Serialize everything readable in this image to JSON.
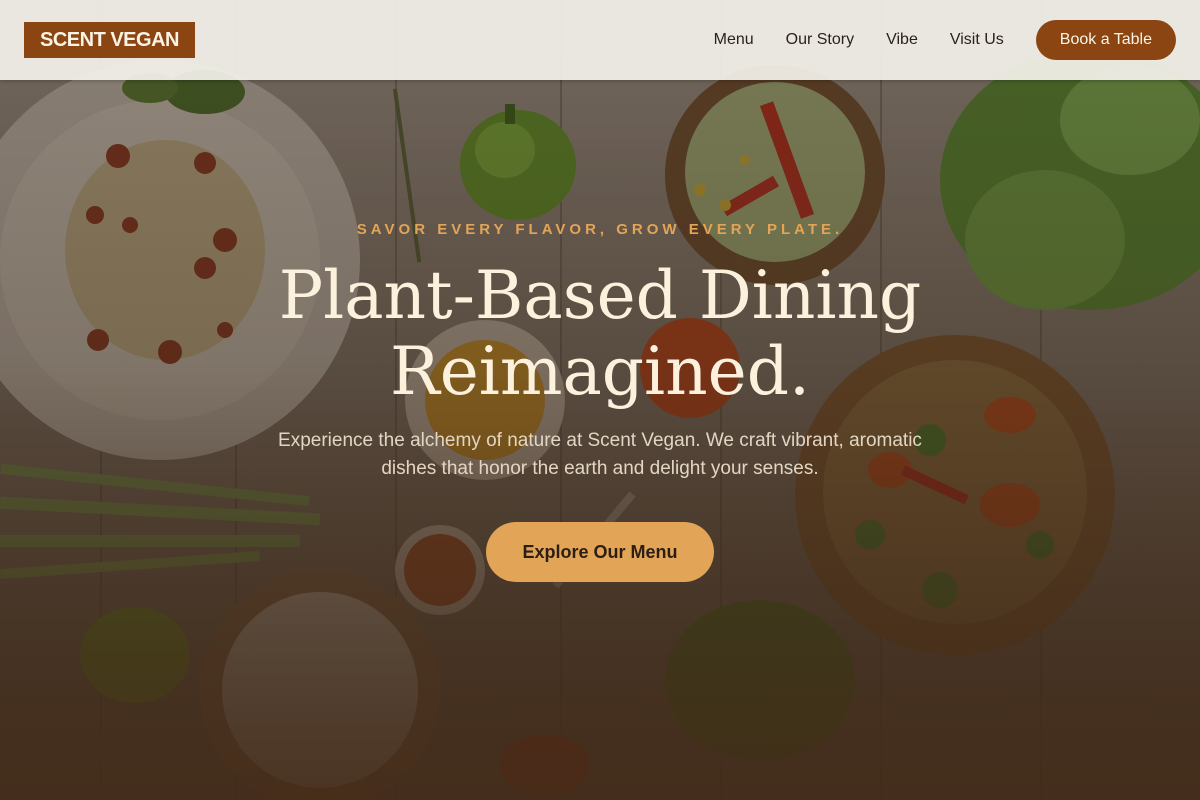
{
  "brand": {
    "logo_text": "SCENT VEGAN"
  },
  "nav": {
    "links": [
      "Menu",
      "Our Story",
      "Vibe",
      "Visit Us"
    ],
    "cta_label": "Book a Table"
  },
  "hero": {
    "tagline": "SAVOR EVERY FLAVOR, GROW EVERY PLATE.",
    "headline_line1": "Plant-Based Dining",
    "headline_line2": "Reimagined.",
    "subtext": "Experience the alchemy of nature at Scent Vegan. We craft vibrant, aromatic dishes that honor the earth and delight your senses.",
    "button_label": "Explore Our Menu",
    "background_image": "food-table-photo"
  },
  "colors": {
    "brand_brown": "#8b4513",
    "accent_gold": "#e2a457",
    "cream_text": "#fbf1dc"
  }
}
